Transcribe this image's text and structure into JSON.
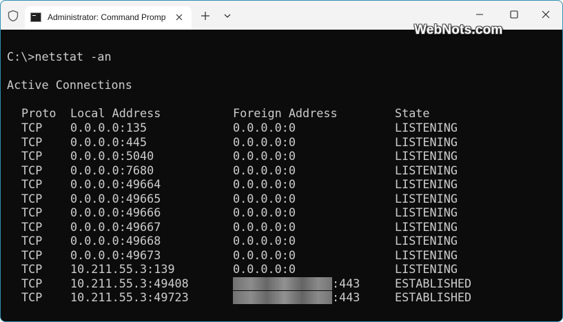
{
  "window": {
    "tab_title": "Administrator: Command Prompt",
    "icons": {
      "admin": "shield-icon",
      "tab": "command-prompt-icon",
      "close_tab": "close-icon",
      "new_tab": "plus-icon",
      "dropdown": "chevron-down-icon",
      "minimize": "minimize-icon",
      "maximize": "maximize-icon",
      "close": "close-icon"
    }
  },
  "terminal": {
    "command_line": "C:\\>netstat -an",
    "section_title": "Active Connections",
    "headers": {
      "proto": "Proto",
      "local": "Local Address",
      "foreign": "Foreign Address",
      "state": "State"
    },
    "rows": [
      {
        "proto": "TCP",
        "local": "0.0.0.0:135",
        "foreign": "0.0.0.0:0",
        "state": "LISTENING"
      },
      {
        "proto": "TCP",
        "local": "0.0.0.0:445",
        "foreign": "0.0.0.0:0",
        "state": "LISTENING"
      },
      {
        "proto": "TCP",
        "local": "0.0.0.0:5040",
        "foreign": "0.0.0.0:0",
        "state": "LISTENING"
      },
      {
        "proto": "TCP",
        "local": "0.0.0.0:7680",
        "foreign": "0.0.0.0:0",
        "state": "LISTENING"
      },
      {
        "proto": "TCP",
        "local": "0.0.0.0:49664",
        "foreign": "0.0.0.0:0",
        "state": "LISTENING"
      },
      {
        "proto": "TCP",
        "local": "0.0.0.0:49665",
        "foreign": "0.0.0.0:0",
        "state": "LISTENING"
      },
      {
        "proto": "TCP",
        "local": "0.0.0.0:49666",
        "foreign": "0.0.0.0:0",
        "state": "LISTENING"
      },
      {
        "proto": "TCP",
        "local": "0.0.0.0:49667",
        "foreign": "0.0.0.0:0",
        "state": "LISTENING"
      },
      {
        "proto": "TCP",
        "local": "0.0.0.0:49668",
        "foreign": "0.0.0.0:0",
        "state": "LISTENING"
      },
      {
        "proto": "TCP",
        "local": "0.0.0.0:49673",
        "foreign": "0.0.0.0:0",
        "state": "LISTENING"
      },
      {
        "proto": "TCP",
        "local": "10.211.55.3:139",
        "foreign": "0.0.0.0:0",
        "state": "LISTENING"
      },
      {
        "proto": "TCP",
        "local": "10.211.55.3:49408",
        "foreign": ":443",
        "state": "ESTABLISHED",
        "foreign_blurred": true
      },
      {
        "proto": "TCP",
        "local": "10.211.55.3:49723",
        "foreign": ":443",
        "state": "ESTABLISHED",
        "foreign_blurred": true
      }
    ]
  },
  "watermark": "WebNots.com",
  "colors": {
    "terminal_bg": "#0c0c0c",
    "terminal_text": "#cccccc",
    "titlebar_bg": "#f3f3f3",
    "tab_bg": "#ffffff",
    "border": "#2f8fb4"
  }
}
